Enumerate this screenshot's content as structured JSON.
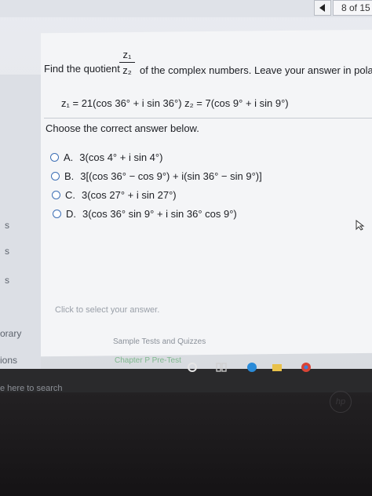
{
  "header": {
    "page_counter": "8 of 15"
  },
  "sidebar": {
    "labels": [
      "s",
      "s",
      "s",
      "orary",
      "ions"
    ]
  },
  "question": {
    "prefix": "Find the quotient",
    "numerator": "z₁",
    "denominator": "z₂",
    "suffix": "of the complex numbers. Leave your answer in polar form.",
    "given": "z₁ = 21(cos 36° + i sin 36°)   z₂ = 7(cos 9° + i sin 9°)"
  },
  "prompt": "Choose the correct answer below.",
  "options": [
    {
      "letter": "A.",
      "text": "3(cos 4° + i sin 4°)"
    },
    {
      "letter": "B.",
      "text": "3[(cos 36° − cos 9°) + i(sin 36° − sin 9°)]"
    },
    {
      "letter": "C.",
      "text": "3(cos 27° + i sin 27°)"
    },
    {
      "letter": "D.",
      "text": "3(cos 36° sin 9° + i sin 36° cos 9°)"
    }
  ],
  "hint": "Click to select your answer.",
  "footer": {
    "faint_link": "Sample Tests and Quizzes",
    "chapter_link": "Chapter P Pre-Test"
  },
  "taskbar": {
    "search_text": "e here to search"
  },
  "logo": "hp",
  "colors": {
    "accent": "#3d6fb5",
    "panel": "#f4f5f7"
  }
}
